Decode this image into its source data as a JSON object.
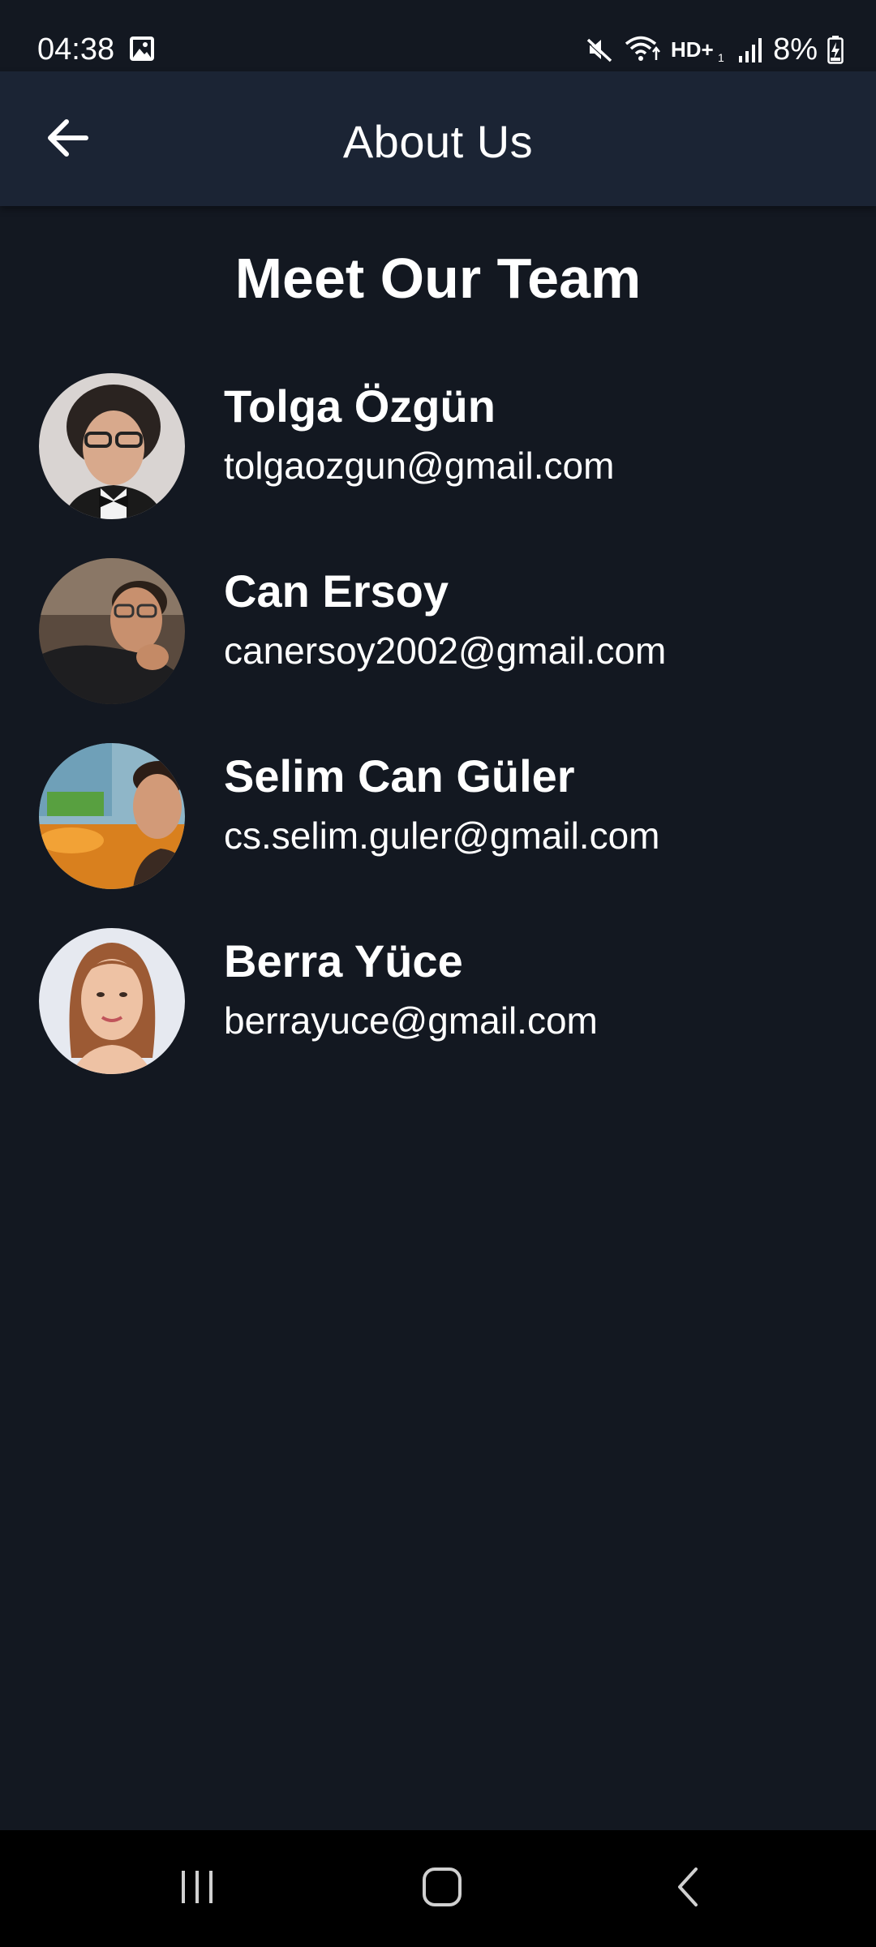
{
  "status_bar": {
    "time": "04:38",
    "battery_percent": "8%",
    "icons": [
      "gallery-icon",
      "mute-icon",
      "wifi-icon",
      "hd-volte-icon",
      "signal-icon",
      "battery-charging-icon"
    ],
    "hd_label": "HD+"
  },
  "app_bar": {
    "title": "About Us",
    "back_icon": "arrow-back-icon"
  },
  "content": {
    "section_title": "Meet Our Team",
    "team": [
      {
        "name": "Tolga Özgün",
        "email": "tolgaozgun@gmail.com",
        "avatar": "avatar-photo"
      },
      {
        "name": "Can Ersoy",
        "email": "canersoy2002@gmail.com",
        "avatar": "avatar-photo"
      },
      {
        "name": "Selim Can Güler",
        "email": "cs.selim.guler@gmail.com",
        "avatar": "avatar-photo"
      },
      {
        "name": "Berra Yüce",
        "email": "berrayuce@gmail.com",
        "avatar": "avatar-photo"
      }
    ]
  },
  "nav_bar": {
    "buttons": [
      "recents-icon",
      "home-icon",
      "back-icon"
    ]
  },
  "colors": {
    "background": "#131821",
    "app_bar": "#1b2434",
    "text": "#ffffff",
    "nav_bar": "#000000"
  }
}
